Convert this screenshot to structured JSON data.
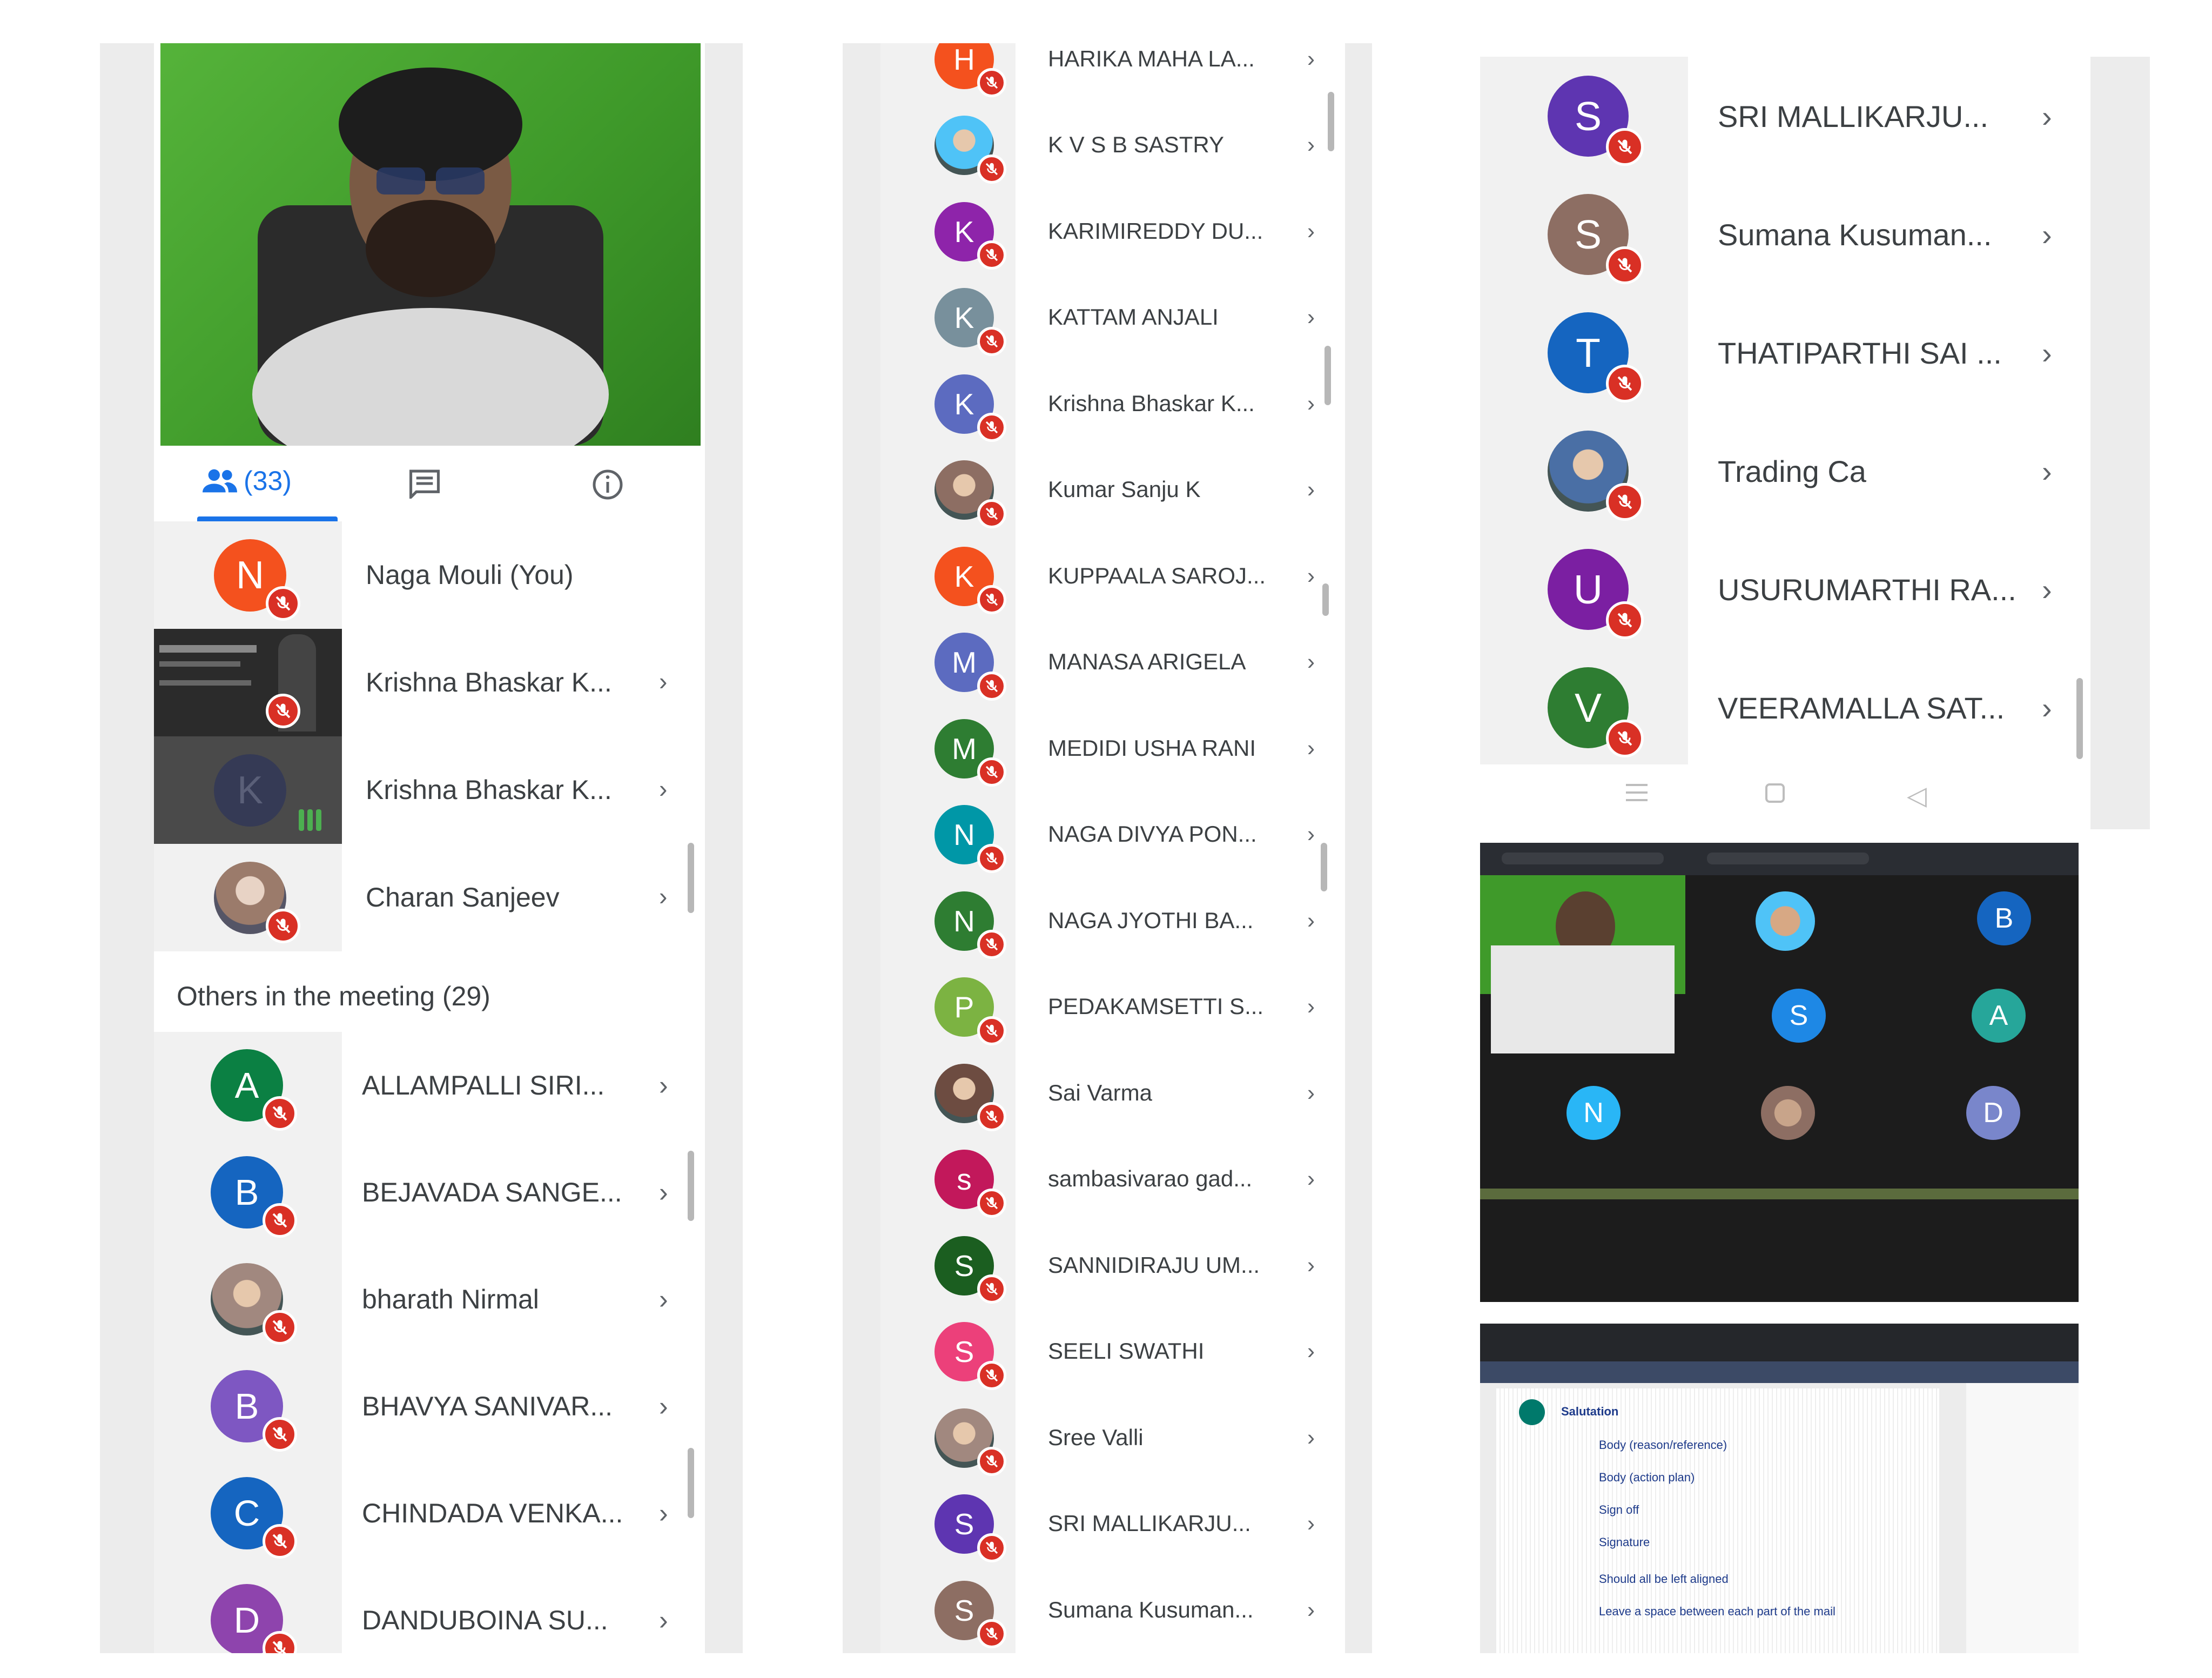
{
  "left_panel": {
    "tabs": {
      "people_count": "(33)"
    },
    "you": {
      "name": "Naga Mouli (You)",
      "initial": "N",
      "color": "#f4511e"
    },
    "pinned": [
      {
        "name": "Krishna Bhaskar K...",
        "type": "slide"
      },
      {
        "name": "Krishna Bhaskar K...",
        "type": "speaking",
        "initial": "K"
      },
      {
        "name": "Charan Sanjeev",
        "type": "photo"
      }
    ],
    "others_header": "Others in the meeting (29)",
    "others": [
      {
        "name": "ALLAMPALLI SIRI...",
        "initial": "A",
        "color": "#0b8043"
      },
      {
        "name": "BEJAVADA SANGE...",
        "initial": "B",
        "color": "#1565c0"
      },
      {
        "name": "bharath Nirmal",
        "initial": "",
        "color": "#a1887f",
        "photo": true
      },
      {
        "name": "BHAVYA SANIVAR...",
        "initial": "B",
        "color": "#7e57c2"
      },
      {
        "name": "CHINDADA VENKA...",
        "initial": "C",
        "color": "#1565c0"
      },
      {
        "name": "DANDUBOINA SU...",
        "initial": "D",
        "color": "#8e44ad"
      }
    ]
  },
  "mid_panel": {
    "people": [
      {
        "name": "HARIKA MAHA LA...",
        "initial": "H",
        "color": "#f4511e"
      },
      {
        "name": "K V S B SASTRY",
        "initial": "",
        "color": "#4fc3f7",
        "photo": true
      },
      {
        "name": "KARIMIREDDY DU...",
        "initial": "K",
        "color": "#8e24aa"
      },
      {
        "name": "KATTAM ANJALI",
        "initial": "K",
        "color": "#78909c"
      },
      {
        "name": "Krishna Bhaskar K...",
        "initial": "K",
        "color": "#5c6bc0"
      },
      {
        "name": "Kumar Sanju K",
        "initial": "",
        "color": "#8d6e63",
        "photo": true
      },
      {
        "name": "KUPPAALA SAROJ...",
        "initial": "K",
        "color": "#f4511e"
      },
      {
        "name": "MANASA ARIGELA",
        "initial": "M",
        "color": "#5c6bc0"
      },
      {
        "name": "MEDIDI USHA RANI",
        "initial": "M",
        "color": "#2e7d32"
      },
      {
        "name": "NAGA DIVYA PON...",
        "initial": "N",
        "color": "#0097a7"
      },
      {
        "name": "NAGA JYOTHI BA...",
        "initial": "N",
        "color": "#2e7d32"
      },
      {
        "name": "PEDAKAMSETTI S...",
        "initial": "P",
        "color": "#7cb342"
      },
      {
        "name": "Sai Varma",
        "initial": "",
        "color": "#6d4c41",
        "photo": true
      },
      {
        "name": "sambasivarao gad...",
        "initial": "s",
        "color": "#c2185b"
      },
      {
        "name": "SANNIDIRAJU UM...",
        "initial": "S",
        "color": "#1b5e20"
      },
      {
        "name": "SEELI SWATHI",
        "initial": "S",
        "color": "#ec407a"
      },
      {
        "name": "Sree Valli",
        "initial": "",
        "color": "#a1887f",
        "photo": true
      },
      {
        "name": "SRI MALLIKARJU...",
        "initial": "S",
        "color": "#5e35b1"
      },
      {
        "name": "Sumana Kusuman...",
        "initial": "S",
        "color": "#8d6e63"
      }
    ]
  },
  "right_panel": {
    "people": [
      {
        "name": "SRI MALLIKARJU...",
        "initial": "S",
        "color": "#5e35b1"
      },
      {
        "name": "Sumana Kusuman...",
        "initial": "S",
        "color": "#8d6e63"
      },
      {
        "name": "THATIPARTHI SAI ...",
        "initial": "T",
        "color": "#1565c0"
      },
      {
        "name": "Trading Ca",
        "initial": "",
        "color": "#4a6fa5",
        "photo": true
      },
      {
        "name": "USURUMARTHI RA...",
        "initial": "U",
        "color": "#7b1fa2"
      },
      {
        "name": "VEERAMALLA SAT...",
        "initial": "V",
        "color": "#2e7d32"
      }
    ]
  },
  "meet_grid": {
    "tiles": [
      {
        "initial": "B",
        "color": "#1565c0"
      },
      {
        "initial": "S",
        "color": "#1e88e5"
      },
      {
        "initial": "A",
        "color": "#26a69a"
      },
      {
        "initial": "N",
        "color": "#29b6f6"
      },
      {
        "initial": "D",
        "color": "#7986cb"
      }
    ]
  },
  "doc_share": {
    "lines": [
      "Salutation",
      "Body (reason/reference)",
      "Body (action plan)",
      "Sign off",
      "Signature",
      "Should all be left aligned",
      "Leave a space between each part of the mail"
    ]
  },
  "colors": {
    "mute": "#d93025",
    "accent": "#1a73e8",
    "teal": "#00796b"
  }
}
